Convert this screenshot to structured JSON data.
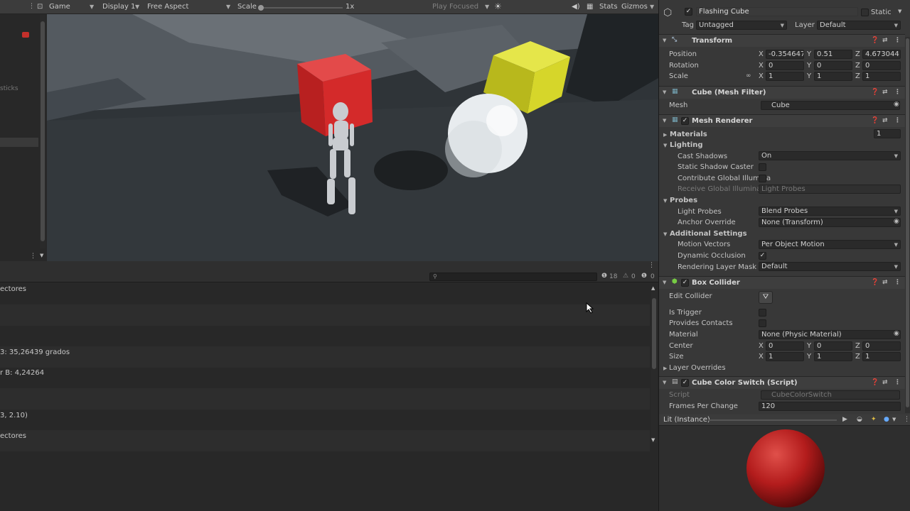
{
  "hierarchy": {
    "partial_text": "sticks"
  },
  "game_toolbar": {
    "tab": "Game",
    "display": "Display 1",
    "aspect": "Free Aspect",
    "scale_label": "Scale",
    "scale_value": "1x",
    "play_mode": "Play Focused",
    "stats": "Stats",
    "gizmos": "Gizmos"
  },
  "console": {
    "counts": {
      "log": "18",
      "warn": "0",
      "error": "0"
    },
    "rows": [
      "ectores",
      "",
      "",
      "3: 35,26439 grados",
      "r B: 4,24264",
      "",
      "3, 2.10)",
      "ectores"
    ]
  },
  "inspector": {
    "object_name": "Flashing Cube",
    "static_label": "Static",
    "tag_label": "Tag",
    "tag_value": "Untagged",
    "layer_label": "Layer",
    "layer_value": "Default",
    "transform": {
      "title": "Transform",
      "position_label": "Position",
      "rotation_label": "Rotation",
      "scale_label": "Scale",
      "position": {
        "x": "-0.354647",
        "y": "0.51",
        "z": "4.673044"
      },
      "rotation": {
        "x": "0",
        "y": "0",
        "z": "0"
      },
      "scale": {
        "x": "1",
        "y": "1",
        "z": "1"
      }
    },
    "mesh_filter": {
      "title": "Cube (Mesh Filter)",
      "mesh_label": "Mesh",
      "mesh_value": "Cube"
    },
    "mesh_renderer": {
      "title": "Mesh Renderer",
      "materials_label": "Materials",
      "materials_count": "1",
      "lighting": "Lighting",
      "cast_shadows_label": "Cast Shadows",
      "cast_shadows_value": "On",
      "static_shadow_label": "Static Shadow Caster",
      "contribute_gi_label": "Contribute Global Illumina",
      "receive_gi_label": "Receive Global Illuminatic",
      "receive_gi_value": "Light Probes",
      "probes": "Probes",
      "light_probes_label": "Light Probes",
      "light_probes_value": "Blend Probes",
      "anchor_label": "Anchor Override",
      "anchor_value": "None (Transform)",
      "additional": "Additional Settings",
      "motion_label": "Motion Vectors",
      "motion_value": "Per Object Motion",
      "dyn_occ_label": "Dynamic Occlusion",
      "layer_mask_label": "Rendering Layer Mask",
      "layer_mask_value": "Default"
    },
    "box_collider": {
      "title": "Box Collider",
      "edit_label": "Edit Collider",
      "trigger_label": "Is Trigger",
      "contacts_label": "Provides Contacts",
      "material_label": "Material",
      "material_value": "None (Physic Material)",
      "center_label": "Center",
      "size_label": "Size",
      "center": {
        "x": "0",
        "y": "0",
        "z": "0"
      },
      "size": {
        "x": "1",
        "y": "1",
        "z": "1"
      },
      "overrides": "Layer Overrides"
    },
    "script": {
      "title": "Cube Color Switch (Script)",
      "script_label": "Script",
      "script_value": "CubeColorSwitch",
      "frames_label": "Frames Per Change",
      "frames_value": "120"
    }
  },
  "preview": {
    "title": "Lit (Instance)"
  },
  "colors": {
    "red_cube": "#d42a2a",
    "yellow_cube": "#d6d62a",
    "sphere": "#e8ecef",
    "preview_sphere": "#b31c1c"
  }
}
